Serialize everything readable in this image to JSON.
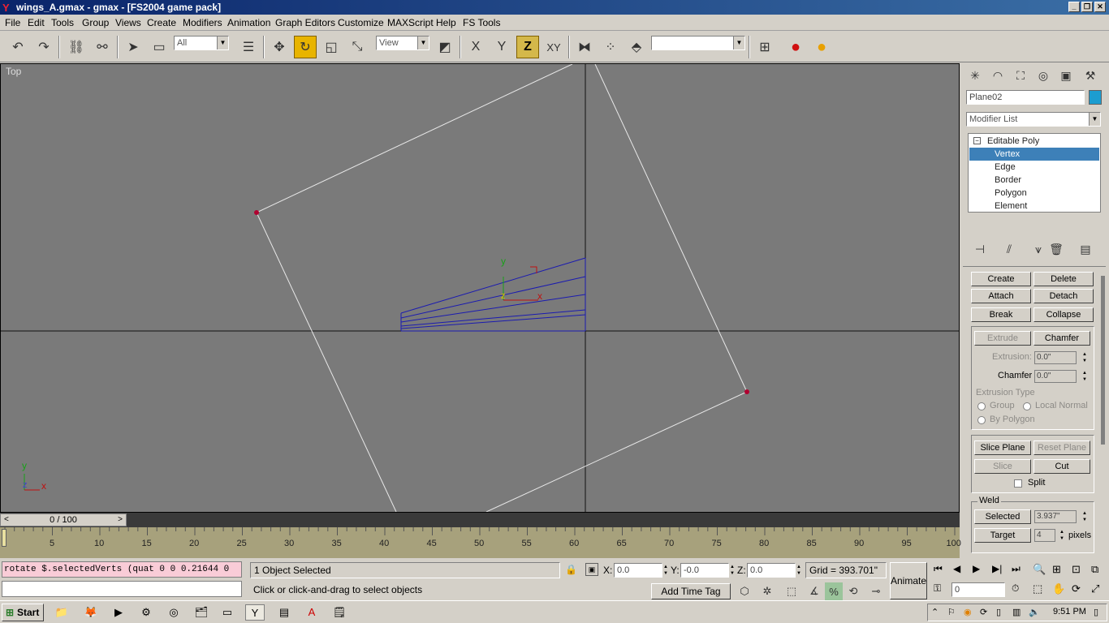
{
  "window": {
    "title": "wings_A.gmax - gmax - [FS2004 game pack]",
    "app_icon": "Y"
  },
  "menu": [
    "File",
    "Edit",
    "Tools",
    "Group",
    "Views",
    "Create",
    "Modifiers",
    "Animation",
    "Graph Editors",
    "Customize",
    "MAXScript",
    "Help",
    "FS Tools"
  ],
  "toolbar": {
    "selection_filter": "All",
    "ref_coord": "View",
    "axis_x": "X",
    "axis_y": "Y",
    "axis_z": "Z",
    "axis_xy": "XY"
  },
  "viewport": {
    "label": "Top",
    "gizmo_y": "y",
    "gizmo_x": "x",
    "gizmo_z": "z",
    "corner_y": "y",
    "corner_x": "x",
    "corner_z": "z"
  },
  "command_panel": {
    "object_name": "Plane02",
    "object_color": "#1c9dd0",
    "modifier_list": "Modifier List",
    "stack": {
      "root": "Editable Poly",
      "items": [
        "Vertex",
        "Edge",
        "Border",
        "Polygon",
        "Element"
      ],
      "selected": "Vertex"
    },
    "buttons": {
      "create": "Create",
      "delete": "Delete",
      "attach": "Attach",
      "detach": "Detach",
      "break": "Break",
      "collapse": "Collapse",
      "extrude": "Extrude",
      "chamfer": "Chamfer",
      "slice_plane": "Slice Plane",
      "reset_plane": "Reset Plane",
      "slice": "Slice",
      "cut": "Cut",
      "selected": "Selected",
      "target": "Target"
    },
    "labels": {
      "extrusion": "Extrusion:",
      "chamfer": "Chamfer",
      "extrusion_type": "Extrusion Type",
      "group": "Group",
      "local_normal": "Local Normal",
      "by_polygon": "By Polygon",
      "split": "Split",
      "weld": "Weld",
      "pixels": "pixels"
    },
    "values": {
      "extrusion": "0.0\"",
      "chamfer": "0.0\"",
      "weld_selected": "3.937\"",
      "weld_target": "4"
    }
  },
  "timeslider": {
    "position": "0 / 100",
    "ticks": [
      "5",
      "10",
      "15",
      "20",
      "25",
      "30",
      "35",
      "40",
      "45",
      "50",
      "55",
      "60",
      "65",
      "70",
      "75",
      "80",
      "85",
      "90",
      "95",
      "100"
    ]
  },
  "status": {
    "maxscript_line": "rotate $.selectedVerts (quat 0 0 0.21644 0",
    "selection_info": "1 Object Selected",
    "prompt": "Click or click-and-drag to select objects",
    "x_label": "X:",
    "x_value": "0.0",
    "y_label": "Y:",
    "y_value": "-0.0",
    "z_label": "Z:",
    "z_value": "0.0",
    "grid": "Grid = 393.701\"",
    "add_time_tag": "Add Time Tag",
    "animate": "Animate",
    "frame": "0"
  },
  "taskbar": {
    "start": "Start",
    "clock": "9:51 PM"
  }
}
